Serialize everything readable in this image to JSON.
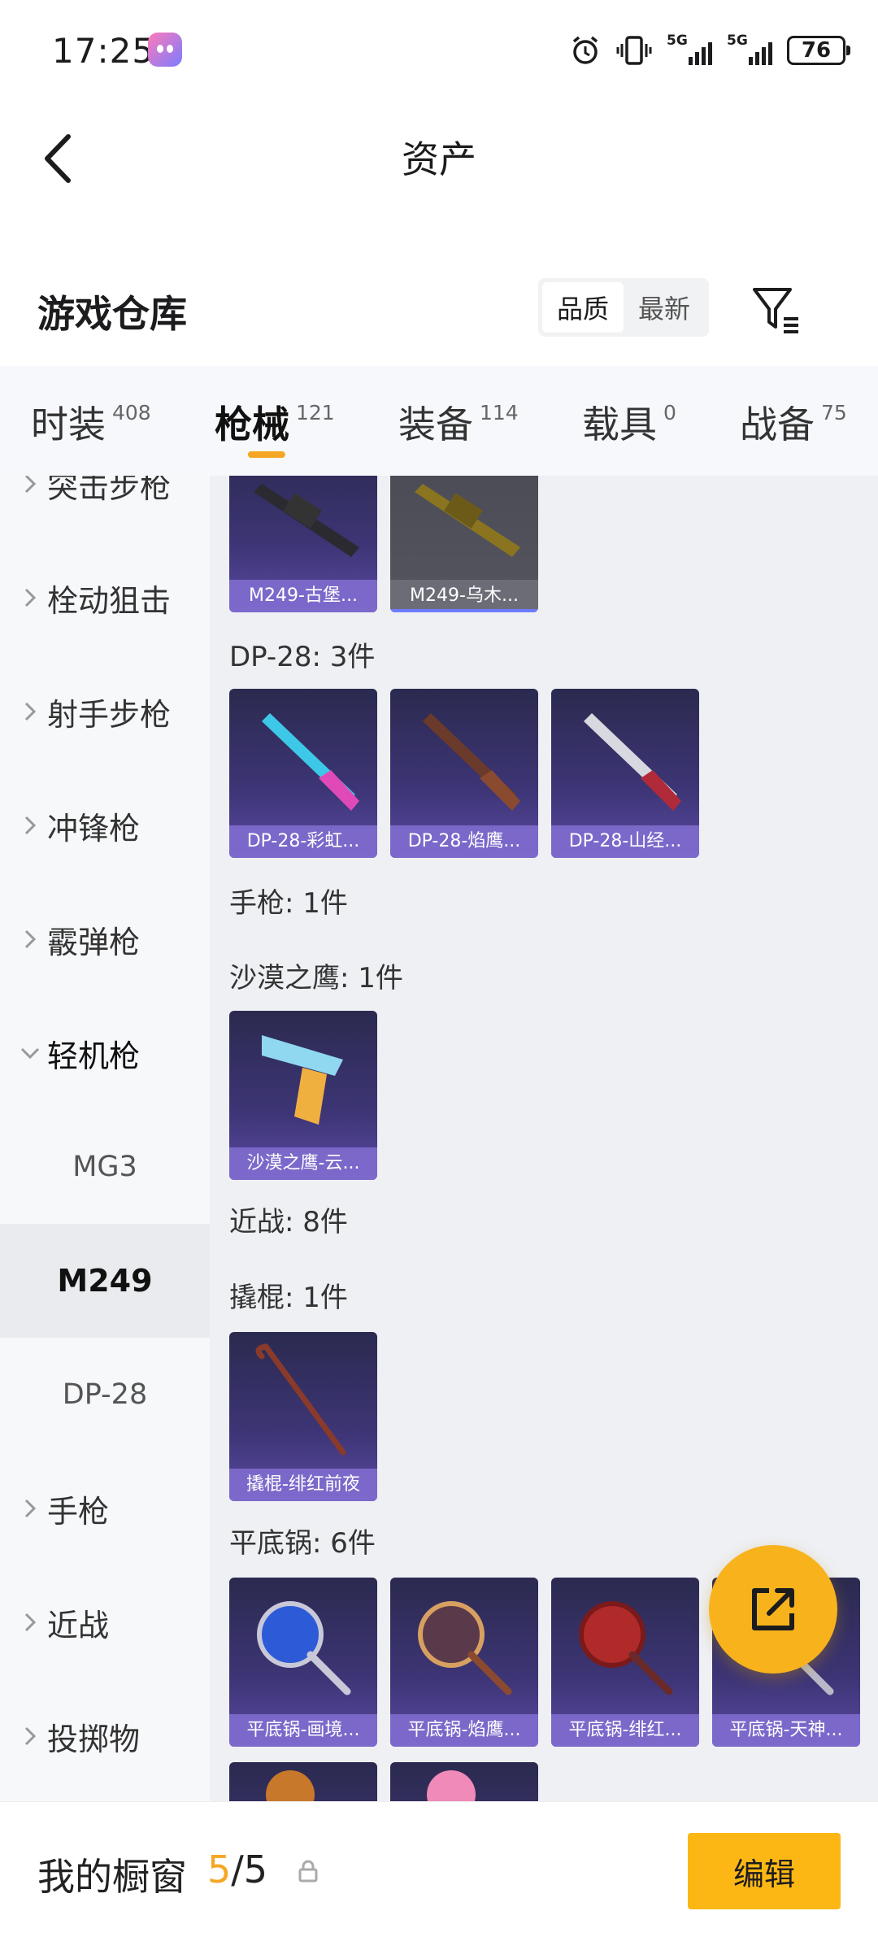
{
  "status_bar": {
    "time": "17:25",
    "signal1": "5G",
    "signal2": "5G",
    "battery": "76"
  },
  "header": {
    "title": "资产"
  },
  "warehouse": {
    "title": "游戏仓库",
    "sort_options": [
      "品质",
      "最新"
    ],
    "active_sort": "品质"
  },
  "tabs": [
    {
      "label": "时装",
      "count": "408"
    },
    {
      "label": "枪械",
      "count": "121"
    },
    {
      "label": "装备",
      "count": "114"
    },
    {
      "label": "载具",
      "count": "0"
    },
    {
      "label": "战备",
      "count": "75"
    }
  ],
  "active_tab": "枪械",
  "sidebar": {
    "items": [
      "突击步枪",
      "栓动狙击",
      "射手步枪",
      "冲锋枪",
      "霰弹枪",
      "轻机枪",
      "手枪",
      "近战",
      "投掷物"
    ],
    "sub_items": [
      "MG3",
      "M249",
      "DP-28"
    ],
    "selected": "M249",
    "expanded": "轻机枪"
  },
  "content": {
    "m249_items": [
      "M249-古堡...",
      "M249-乌木..."
    ],
    "dp28_header": "DP-28: 3件",
    "dp28_items": [
      "DP-28-彩虹...",
      "DP-28-焰鹰...",
      "DP-28-山经..."
    ],
    "pistol_header": "手枪: 1件",
    "deagle_header": "沙漠之鹰: 1件",
    "deagle_items": [
      "沙漠之鹰-云..."
    ],
    "melee_header": "近战: 8件",
    "crowbar_header": "撬棍: 1件",
    "crowbar_items": [
      "撬棍-绯红前夜"
    ],
    "pan_header": "平底锅: 6件",
    "pan_items": [
      "平底锅-画境...",
      "平底锅-焰鹰...",
      "平底锅-绯红...",
      "平底锅-天神..."
    ]
  },
  "bottom_bar": {
    "title": "我的橱窗",
    "current": "5",
    "total": "/5",
    "edit_label": "编辑"
  },
  "colors": {
    "accent": "#f5a623",
    "button": "#fdb714",
    "card": "#3d3576"
  }
}
